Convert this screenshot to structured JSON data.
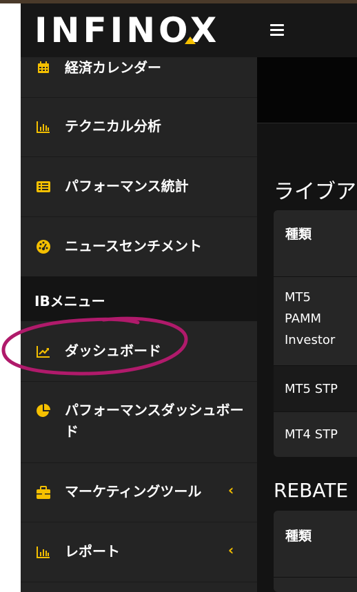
{
  "header": {
    "logo_text": "INFINOX",
    "menu_icon": "hamburger-icon"
  },
  "sidebar": {
    "items": [
      {
        "label": "経済カレンダー",
        "icon": "calendar-icon"
      },
      {
        "label": "テクニカル分析",
        "icon": "bar-chart-icon"
      },
      {
        "label": "パフォーマンス統計",
        "icon": "list-card-icon"
      },
      {
        "label": "ニュースセンチメント",
        "icon": "gauge-icon"
      }
    ],
    "section_title": "IBメニュー",
    "ib_items": [
      {
        "label": "ダッシュボード",
        "icon": "line-chart-icon"
      },
      {
        "label": "パフォーマンスダッシュボード",
        "icon": "pie-chart-icon"
      },
      {
        "label": "マーケティングツール",
        "icon": "briefcase-icon",
        "chevron": "‹"
      },
      {
        "label": "レポート",
        "icon": "bar-chart-icon",
        "chevron": "‹"
      }
    ]
  },
  "main": {
    "heading_live": "ライブア",
    "live_table": {
      "header": "種類",
      "rows": [
        {
          "lines": [
            "MT5",
            "PAMM",
            "Investor"
          ]
        },
        {
          "lines": [
            "MT5 STP"
          ]
        },
        {
          "lines": [
            "MT4 STP"
          ]
        }
      ]
    },
    "heading_rebate": "REBATE",
    "rebate_table": {
      "header": "種類"
    }
  },
  "colors": {
    "accent": "#f5c000",
    "sidebar_bg": "#242424",
    "annotation": "#b01a6b"
  }
}
